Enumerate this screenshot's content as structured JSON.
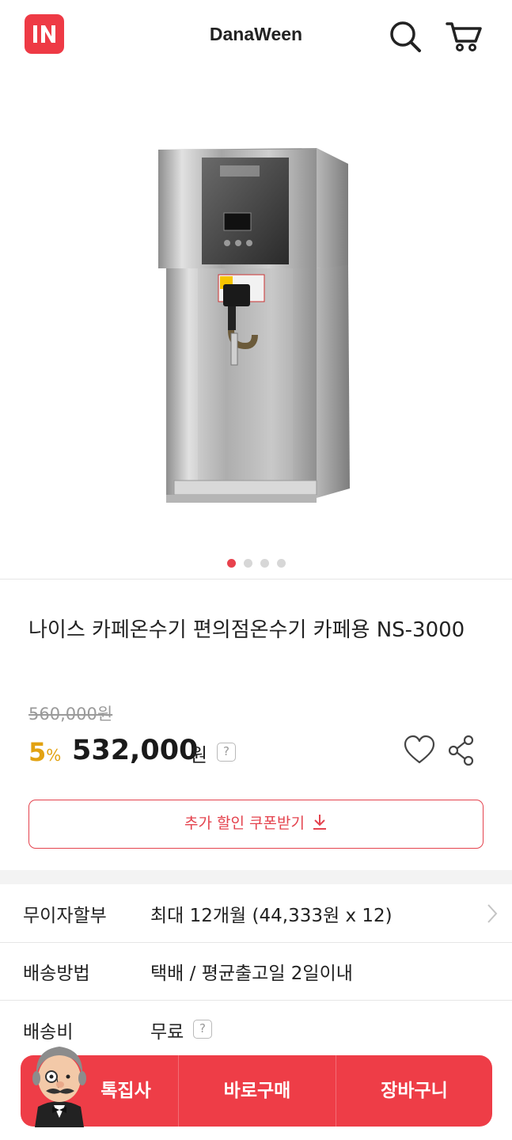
{
  "header": {
    "title": "DanaWeen",
    "logo_icon": "in-logo-icon",
    "search_icon": "search-icon",
    "cart_icon": "cart-icon",
    "brand_color": "#ee3a45"
  },
  "gallery": {
    "image": "stainless water dispenser",
    "slide_count": 4,
    "active_slide": 1
  },
  "product": {
    "title": "나이스 카페온수기 편의점온수기 카페용 NS-3000",
    "original_price": "560,000원",
    "discount_number": "5",
    "discount_unit": "%",
    "price": "532,000",
    "currency": "원",
    "help": "?",
    "discount_color": "#e2a212"
  },
  "coupon": {
    "label": "추가 할인 쿠폰받기"
  },
  "info": {
    "installment": {
      "label": "무이자할부",
      "value": "최대 12개월 (44,333원 x 12)"
    },
    "shipping": {
      "label": "배송방법",
      "value": "택배 / 평균출고일 2일이내"
    },
    "fee": {
      "label": "배송비",
      "value": "무료"
    }
  },
  "bottom_bar": {
    "special": "톡집사",
    "buy_now": "바로구매",
    "cart": "장바구니",
    "color": "#ee3d47"
  }
}
